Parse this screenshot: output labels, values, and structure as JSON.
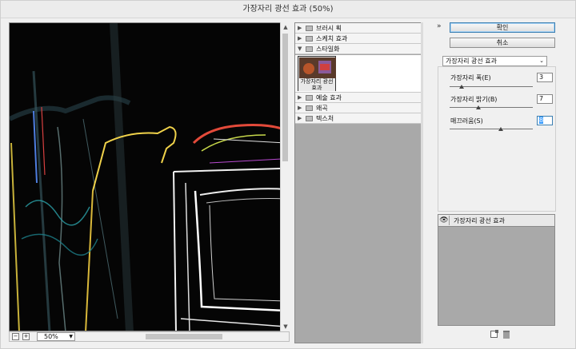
{
  "window": {
    "title": "가장자리 광선 효과 (50%)"
  },
  "preview": {
    "zoom_value": "50%",
    "zoom_minus": "−",
    "zoom_plus": "+"
  },
  "gallery": {
    "folders": [
      {
        "label": "브러시 획",
        "expanded": false
      },
      {
        "label": "스케치 효과",
        "expanded": false
      },
      {
        "label": "스타일화",
        "expanded": true
      },
      {
        "label": "예술 효과",
        "expanded": false
      },
      {
        "label": "왜곡",
        "expanded": false
      },
      {
        "label": "텍스처",
        "expanded": false
      }
    ],
    "thumbnail_label": "가장자리 광선 효과"
  },
  "controls": {
    "ok_label": "확인",
    "cancel_label": "취소",
    "filter_selected": "가장자리 광선 효과",
    "params": [
      {
        "label": "가장자리 폭(E)",
        "value": "3",
        "slider_fraction": 0.14
      },
      {
        "label": "가장자리 밝기(B)",
        "value": "7",
        "slider_fraction": 0.35
      },
      {
        "label": "매끄러움(S)",
        "value": "8",
        "slider_fraction": 0.62
      }
    ]
  },
  "layers": {
    "items": [
      {
        "label": "가장자리 광선 효과",
        "visible": true
      }
    ]
  },
  "icons": {
    "collapse": "double-chevron-up-icon",
    "eye": "eye-icon",
    "new_layer": "new-effect-layer-icon",
    "trash": "trash-icon"
  }
}
